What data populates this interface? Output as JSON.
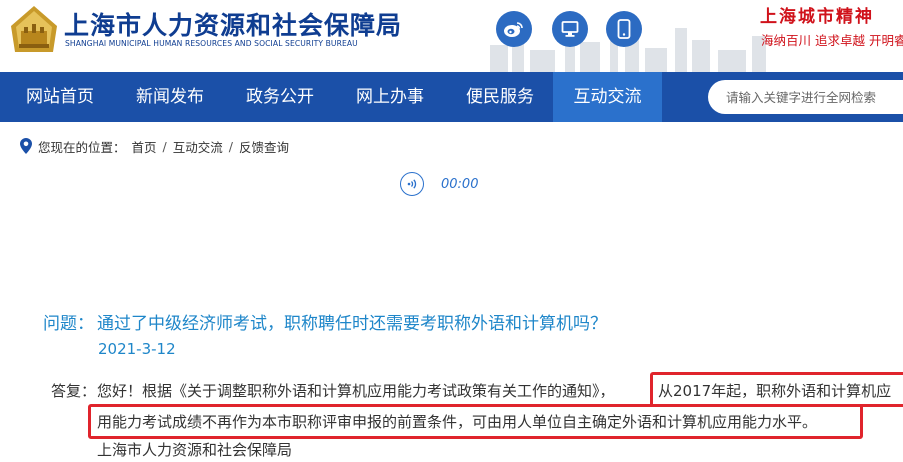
{
  "header": {
    "title": "上海市人力资源和社会保障局",
    "subtitle": "SHANGHAI MUNICIPAL HUMAN RESOURCES AND SOCIAL SECURITY BUREAU",
    "spirit_title": "上海城市精神",
    "spirit_sub": "海纳百川  追求卓越  开明睿智",
    "social_icons": [
      "weibo-icon",
      "computer-icon",
      "mobile-icon"
    ],
    "brand_color": "#0f3d91",
    "spirit_color": "#d0121b"
  },
  "nav": {
    "items": [
      {
        "label": "网站首页",
        "active": false
      },
      {
        "label": "新闻发布",
        "active": false
      },
      {
        "label": "政务公开",
        "active": false
      },
      {
        "label": "网上办事",
        "active": false
      },
      {
        "label": "便民服务",
        "active": false
      },
      {
        "label": "互动交流",
        "active": true
      }
    ],
    "search_placeholder": "请输入关键字进行全网检索",
    "bar_color": "#1b50a8",
    "active_color": "#2b71cc"
  },
  "breadcrumb": {
    "label": "您现在的位置：",
    "items": [
      "首页",
      "互动交流",
      "反馈查询"
    ]
  },
  "audio": {
    "time": "00:00"
  },
  "qa": {
    "question_label": "问题：",
    "question": "通过了中级经济师考试，职称聘任时还需要考职称外语和计算机吗？",
    "date": "2021-3-12",
    "answer_label": "答复：",
    "answer_line1": "您好！根据《关于调整职称外语和计算机应用能力考试政策有关工作的通知》，",
    "answer_line1_highlight": "从2017年起，职称外语和计算机应",
    "answer_line2": "用能力考试成绩不再作为本市职称评审申报的前置条件，可由用人单位自主确定外语和计算机应用能力水平。",
    "signature": "上海市人力资源和社会保障局",
    "highlight_color": "#e0242c"
  }
}
